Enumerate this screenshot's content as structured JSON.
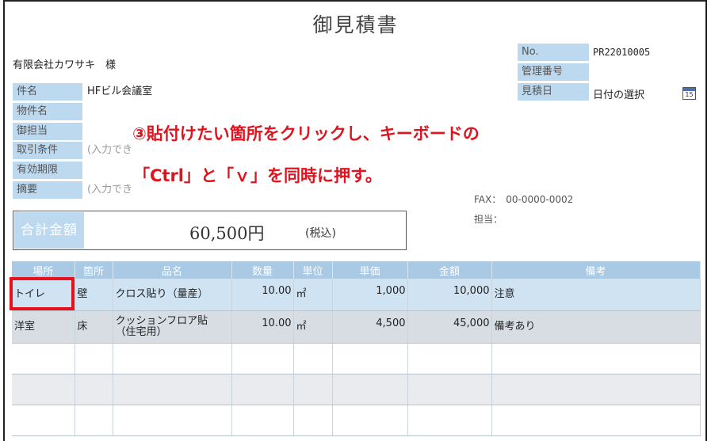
{
  "document_title": "御見積書",
  "customer": "有限会社カワサキ　様",
  "info_fields": [
    {
      "label": "件名",
      "value": "HFビル会議室"
    },
    {
      "label": "物件名",
      "value": ""
    },
    {
      "label": "御担当",
      "value": ""
    },
    {
      "label": "取引条件",
      "value": "(入力でき"
    },
    {
      "label": "有効期限",
      "value": ""
    },
    {
      "label": "摘要",
      "value": "(入力でき"
    }
  ],
  "right_fields": [
    {
      "label": "No.",
      "value": "PR22010005"
    },
    {
      "label": "管理番号",
      "value": ""
    },
    {
      "label": "見積日",
      "value": "日付の選択"
    }
  ],
  "calendar_icon": "15",
  "fax": "FAX：　00-0000-0002",
  "tanto": "担当：",
  "total": {
    "label": "合計金額",
    "amount": "60,500円",
    "tax": "(税込)"
  },
  "annotation": {
    "line1": "③貼付けたい箇所をクリックし、キーボードの",
    "line2": "「Ctrl」と「ｖ」を同時に押す。",
    "color": "#e0141e"
  },
  "table": {
    "headers": [
      "場所",
      "箇所",
      "品名",
      "数量",
      "単位",
      "単価",
      "金額",
      "備考"
    ],
    "rows": [
      {
        "place": "トイレ",
        "part": "壁",
        "name": "クロス貼り（量産）",
        "name2": "",
        "qty": "10.00",
        "unit": "㎡",
        "price": "1,000",
        "amount": "10,000",
        "note": "注意"
      },
      {
        "place": "洋室",
        "part": "床",
        "name": "クッションフロア貼",
        "name2": "（住宅用）",
        "qty": "10.00",
        "unit": "㎡",
        "price": "4,500",
        "amount": "45,000",
        "note": "備考あり"
      }
    ]
  }
}
